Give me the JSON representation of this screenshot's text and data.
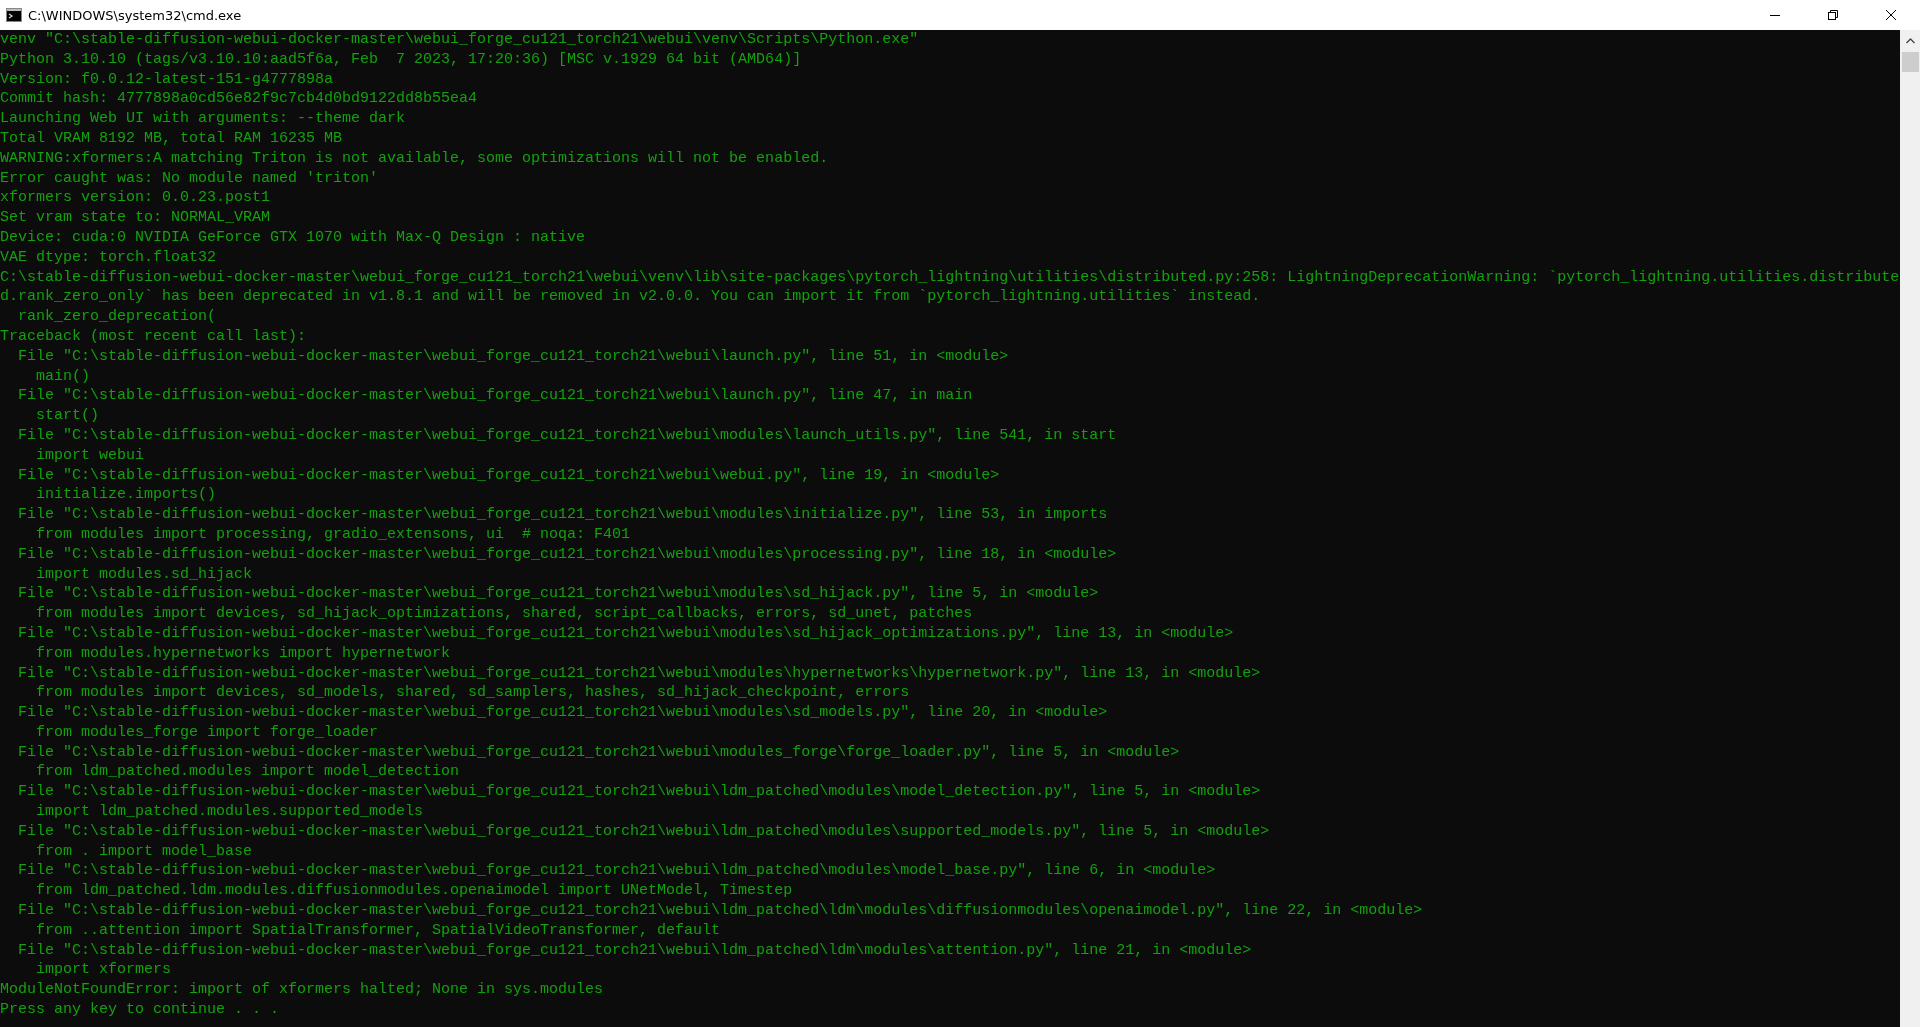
{
  "window": {
    "title": "C:\\WINDOWS\\system32\\cmd.exe"
  },
  "lines": [
    "venv \"C:\\stable-diffusion-webui-docker-master\\webui_forge_cu121_torch21\\webui\\venv\\Scripts\\Python.exe\"",
    "Python 3.10.10 (tags/v3.10.10:aad5f6a, Feb  7 2023, 17:20:36) [MSC v.1929 64 bit (AMD64)]",
    "Version: f0.0.12-latest-151-g4777898a",
    "Commit hash: 4777898a0cd56e82f9c7cb4d0bd9122dd8b55ea4",
    "Launching Web UI with arguments: --theme dark",
    "Total VRAM 8192 MB, total RAM 16235 MB",
    "WARNING:xformers:A matching Triton is not available, some optimizations will not be enabled.",
    "Error caught was: No module named 'triton'",
    "xformers version: 0.0.23.post1",
    "Set vram state to: NORMAL_VRAM",
    "Device: cuda:0 NVIDIA GeForce GTX 1070 with Max-Q Design : native",
    "VAE dtype: torch.float32",
    "C:\\stable-diffusion-webui-docker-master\\webui_forge_cu121_torch21\\webui\\venv\\lib\\site-packages\\pytorch_lightning\\utilities\\distributed.py:258: LightningDeprecationWarning: `pytorch_lightning.utilities.distribute",
    "d.rank_zero_only` has been deprecated in v1.8.1 and will be removed in v2.0.0. You can import it from `pytorch_lightning.utilities` instead.",
    "  rank_zero_deprecation(",
    "Traceback (most recent call last):",
    "  File \"C:\\stable-diffusion-webui-docker-master\\webui_forge_cu121_torch21\\webui\\launch.py\", line 51, in <module>",
    "    main()",
    "  File \"C:\\stable-diffusion-webui-docker-master\\webui_forge_cu121_torch21\\webui\\launch.py\", line 47, in main",
    "    start()",
    "  File \"C:\\stable-diffusion-webui-docker-master\\webui_forge_cu121_torch21\\webui\\modules\\launch_utils.py\", line 541, in start",
    "    import webui",
    "  File \"C:\\stable-diffusion-webui-docker-master\\webui_forge_cu121_torch21\\webui\\webui.py\", line 19, in <module>",
    "    initialize.imports()",
    "  File \"C:\\stable-diffusion-webui-docker-master\\webui_forge_cu121_torch21\\webui\\modules\\initialize.py\", line 53, in imports",
    "    from modules import processing, gradio_extensons, ui  # noqa: F401",
    "  File \"C:\\stable-diffusion-webui-docker-master\\webui_forge_cu121_torch21\\webui\\modules\\processing.py\", line 18, in <module>",
    "    import modules.sd_hijack",
    "  File \"C:\\stable-diffusion-webui-docker-master\\webui_forge_cu121_torch21\\webui\\modules\\sd_hijack.py\", line 5, in <module>",
    "    from modules import devices, sd_hijack_optimizations, shared, script_callbacks, errors, sd_unet, patches",
    "  File \"C:\\stable-diffusion-webui-docker-master\\webui_forge_cu121_torch21\\webui\\modules\\sd_hijack_optimizations.py\", line 13, in <module>",
    "    from modules.hypernetworks import hypernetwork",
    "  File \"C:\\stable-diffusion-webui-docker-master\\webui_forge_cu121_torch21\\webui\\modules\\hypernetworks\\hypernetwork.py\", line 13, in <module>",
    "    from modules import devices, sd_models, shared, sd_samplers, hashes, sd_hijack_checkpoint, errors",
    "  File \"C:\\stable-diffusion-webui-docker-master\\webui_forge_cu121_torch21\\webui\\modules\\sd_models.py\", line 20, in <module>",
    "    from modules_forge import forge_loader",
    "  File \"C:\\stable-diffusion-webui-docker-master\\webui_forge_cu121_torch21\\webui\\modules_forge\\forge_loader.py\", line 5, in <module>",
    "    from ldm_patched.modules import model_detection",
    "  File \"C:\\stable-diffusion-webui-docker-master\\webui_forge_cu121_torch21\\webui\\ldm_patched\\modules\\model_detection.py\", line 5, in <module>",
    "    import ldm_patched.modules.supported_models",
    "  File \"C:\\stable-diffusion-webui-docker-master\\webui_forge_cu121_torch21\\webui\\ldm_patched\\modules\\supported_models.py\", line 5, in <module>",
    "    from . import model_base",
    "  File \"C:\\stable-diffusion-webui-docker-master\\webui_forge_cu121_torch21\\webui\\ldm_patched\\modules\\model_base.py\", line 6, in <module>",
    "    from ldm_patched.ldm.modules.diffusionmodules.openaimodel import UNetModel, Timestep",
    "  File \"C:\\stable-diffusion-webui-docker-master\\webui_forge_cu121_torch21\\webui\\ldm_patched\\ldm\\modules\\diffusionmodules\\openaimodel.py\", line 22, in <module>",
    "    from ..attention import SpatialTransformer, SpatialVideoTransformer, default",
    "  File \"C:\\stable-diffusion-webui-docker-master\\webui_forge_cu121_torch21\\webui\\ldm_patched\\ldm\\modules\\attention.py\", line 21, in <module>",
    "    import xformers",
    "ModuleNotFoundError: import of xformers halted; None in sys.modules",
    "Press any key to continue . . ."
  ]
}
